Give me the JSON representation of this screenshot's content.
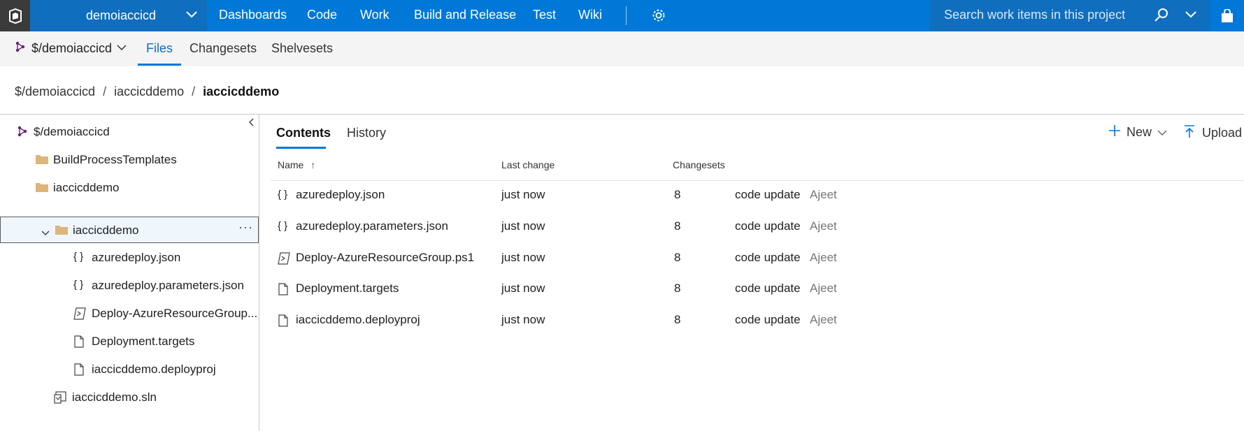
{
  "topbar": {
    "project": "demoiaccicd",
    "nav": [
      "Dashboards",
      "Code",
      "Work",
      "Build and Release",
      "Test",
      "Wiki"
    ],
    "search_placeholder": "Search work items in this project"
  },
  "subnav": {
    "repo": "$/demoiaccicd",
    "tabs": [
      "Files",
      "Changesets",
      "Shelvesets"
    ]
  },
  "breadcrumb": [
    "$/demoiaccicd",
    "iaccicddemo",
    "iaccicddemo"
  ],
  "tree": [
    {
      "label": "$/demoiaccicd",
      "icon": "repo-icon"
    },
    {
      "label": "BuildProcessTemplates",
      "icon": "folder-icon"
    },
    {
      "label": "iaccicddemo",
      "icon": "folder-icon"
    },
    {
      "label": "iaccicddemo",
      "icon": "folder-icon",
      "selected": true,
      "more": "···"
    },
    {
      "label": "azuredeploy.json",
      "icon": "json-icon"
    },
    {
      "label": "azuredeploy.parameters.json",
      "icon": "json-icon"
    },
    {
      "label": "Deploy-AzureResourceGroup...",
      "icon": "powershell-icon"
    },
    {
      "label": "Deployment.targets",
      "icon": "file-icon"
    },
    {
      "label": "iaccicddemo.deployproj",
      "icon": "file-icon"
    },
    {
      "label": "iaccicddemo.sln",
      "icon": "solution-icon"
    }
  ],
  "content": {
    "tabs": [
      "Contents",
      "History"
    ],
    "commands": {
      "new": "New",
      "upload": "Upload"
    },
    "columns": {
      "name": "Name",
      "last_change": "Last change",
      "changesets": "Changesets"
    },
    "sort_arrow": "↑",
    "files": [
      {
        "name": "azuredeploy.json",
        "icon": "json-icon",
        "last_change": "just now",
        "changeset": "8",
        "comment": "code update",
        "author": "Ajeet"
      },
      {
        "name": "azuredeploy.parameters.json",
        "icon": "json-icon",
        "last_change": "just now",
        "changeset": "8",
        "comment": "code update",
        "author": "Ajeet"
      },
      {
        "name": "Deploy-AzureResourceGroup.ps1",
        "icon": "powershell-icon",
        "last_change": "just now",
        "changeset": "8",
        "comment": "code update",
        "author": "Ajeet"
      },
      {
        "name": "Deployment.targets",
        "icon": "file-icon",
        "last_change": "just now",
        "changeset": "8",
        "comment": "code update",
        "author": "Ajeet"
      },
      {
        "name": "iaccicddemo.deployproj",
        "icon": "file-icon",
        "last_change": "just now",
        "changeset": "8",
        "comment": "code update",
        "author": "Ajeet"
      }
    ]
  },
  "colors": {
    "accent": "#0078d7",
    "topbar_dark": "#106ebe",
    "logo_bg": "#3b3b3b",
    "folder": "#dcb67a",
    "repo": "#68217a"
  }
}
